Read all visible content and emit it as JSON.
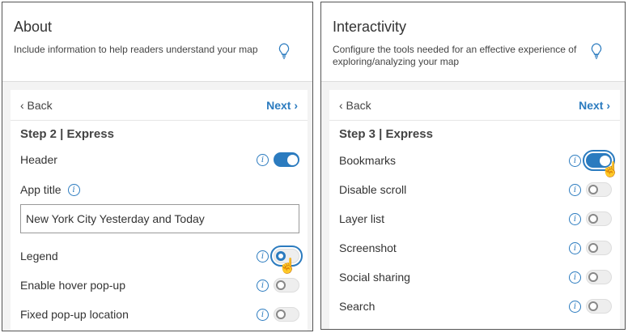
{
  "about": {
    "title": "About",
    "description": "Include information to help readers understand your map",
    "back": "‹ Back",
    "next": "Next ›",
    "step": "Step 2 | Express",
    "rows": [
      {
        "label": "Header",
        "on": true
      },
      {
        "label": "Legend",
        "on": false
      },
      {
        "label": "Enable hover pop-up",
        "on": false
      },
      {
        "label": "Fixed pop-up location",
        "on": false
      }
    ],
    "app_title_label": "App title",
    "app_title_value": "New York City Yesterday and Today"
  },
  "interactivity": {
    "title": "Interactivity",
    "description": "Configure the tools needed for an effective experience of exploring/analyzing your map",
    "back": "‹ Back",
    "next": "Next ›",
    "step": "Step 3 | Express",
    "rows": [
      {
        "label": "Bookmarks",
        "on": true
      },
      {
        "label": "Disable scroll",
        "on": false
      },
      {
        "label": "Layer list",
        "on": false
      },
      {
        "label": "Screenshot",
        "on": false
      },
      {
        "label": "Social sharing",
        "on": false
      },
      {
        "label": "Search",
        "on": false
      }
    ]
  },
  "icons": {
    "info": "i"
  },
  "accent": "#2b7bbf"
}
